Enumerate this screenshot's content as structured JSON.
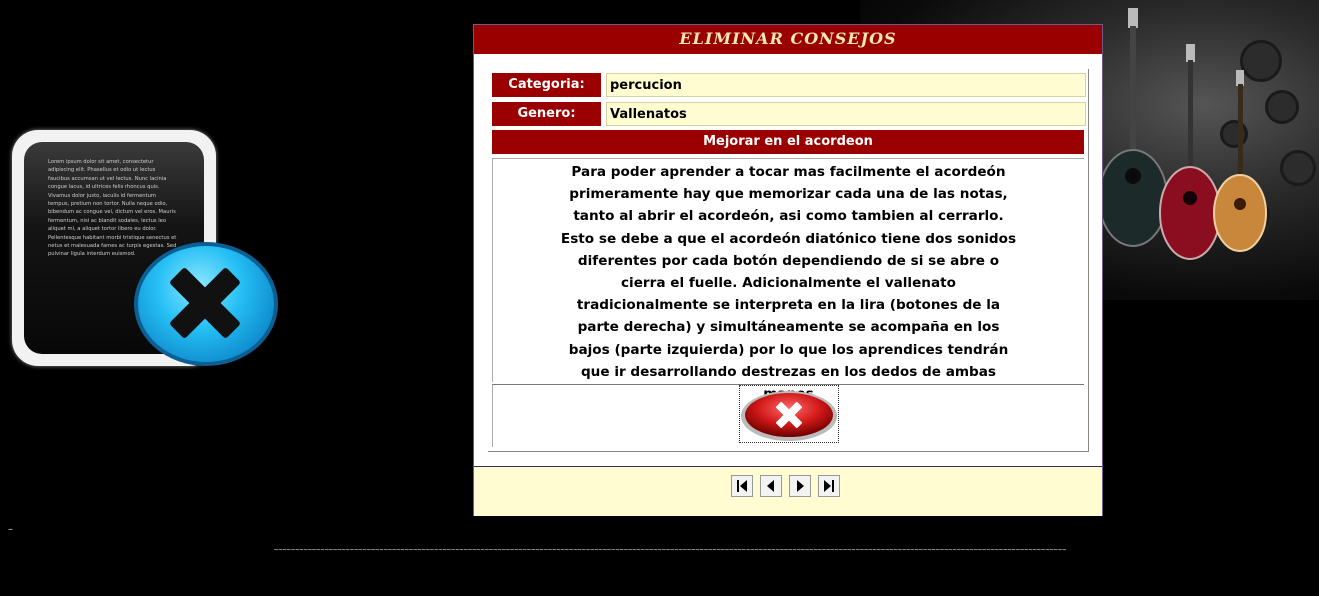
{
  "panel": {
    "title": "ELIMINAR CONSEJOS",
    "category_label": "Categoria:",
    "category_value": "percucion",
    "genre_label": "Genero:",
    "genre_value": "Vallenatos",
    "tip_title": "Mejorar en el acordeon",
    "tip_body": "Para poder aprender a tocar mas facilmente el acordeón primeramente hay que memorizar cada una de las notas, tanto al abrir el acordeón, asi como tambien al cerrarlo. Esto se debe a que el acordeón diatónico tiene dos sonidos diferentes por cada botón dependiendo de si se abre o cierra el fuelle. Adicionalmente el vallenato tradicionalmente se interpreta en la lira (botones de la parte derecha) y simultáneamente se acompaña en los bajos (parte izquierda) por lo que los aprendices tendrán que ir desarrollando destrezas en los dedos de ambas manos"
  },
  "icons": {
    "delete": "delete-x-icon",
    "nav_first": "first-page-icon",
    "nav_prev": "previous-icon",
    "nav_next": "next-icon",
    "nav_last": "last-page-icon"
  },
  "decoration": {
    "left_doc_text": "Lorem ipsum dolor sit amet, consectetur adipiscing elit. Phasellus et odio ut lectus faucibus accumsan ut vel lectus. Nunc lacinia congue lacus, id ultrices felis rhoncus quis. Vivamus dolor justo, iaculis id fermentum tempus, pretium non tortor. Nulla neque odio, bibendum ac congue vel, dictum vel eros. Mauris fermentum, nisi ac blandit sodales, lectus leo aliquet mi, a aliquet tortor libero eu dolor. Pellentesque habitant morbi tristique senectus et netus et malesuada fames ac turpis egestas. Sed pulvinar ligula interdum euismod.",
    "bottom_left_mark": "–",
    "bottom_line": "~~~~~~~~~~~~~~~~~~~~~~~~~~~~~~~~~~~~~~~~~~~~~~~~~~~~~~~~~~~~~~~~~~~~~~~~~~~~~~~~~~~~~~~~~~~~~~~~~~~~~~~~~~~~~~~~~~~~~~~~~~~~~~~~~~~~~~~~~~~~~~~~~~~~~~~~~~~~~~~~~~~~~~~~~~~~~~~~~~~~~~~~~~~~~"
  },
  "colors": {
    "header_red": "#9b0000",
    "cream": "#fffcd2",
    "background": "#000000"
  }
}
